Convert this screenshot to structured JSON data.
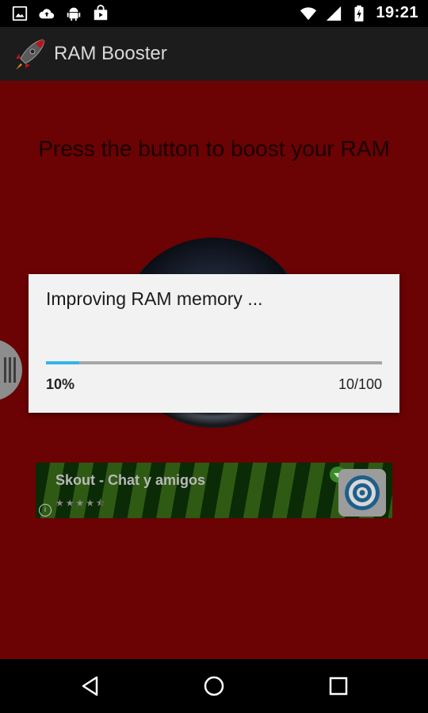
{
  "status_bar": {
    "time": "19:21",
    "icons_left": [
      "image-icon",
      "cloud-upload-icon",
      "android-icon",
      "shopping-bag-icon"
    ],
    "icons_right": [
      "wifi-icon",
      "signal-icon",
      "battery-charging-icon"
    ]
  },
  "action_bar": {
    "title": "RAM Booster",
    "logo": "rocket-logo"
  },
  "main": {
    "instruction": "Press the button to boost your RAM"
  },
  "ad": {
    "title": "Skout - Chat y amigos",
    "stars": "★★★★⯪",
    "info": "i"
  },
  "dialog": {
    "message": "Improving RAM memory ...",
    "progress_value": 10,
    "progress_max": 100,
    "percent_label": "10%",
    "count_label": "10/100"
  },
  "colors": {
    "background_red": "#6b0203",
    "action_bar": "#1c1c1c",
    "progress_accent": "#33b5e5",
    "dialog_bg": "#f2f2f2"
  }
}
